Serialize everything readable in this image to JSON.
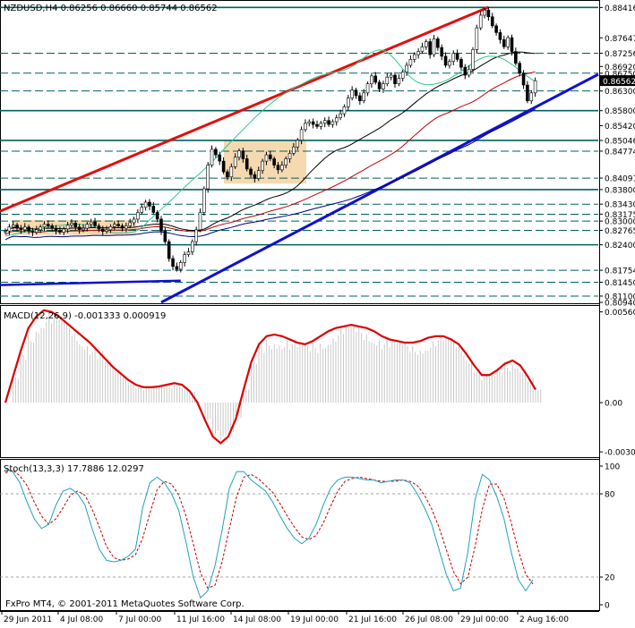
{
  "window": {
    "symbol_header": "NZDUSD,H4  0.86256 0.86660 0.85744 0.86562",
    "copyright": "FxPro MT4, © 2001-2011 MetaQuotes Software Corp."
  },
  "colors": {
    "background": "#ffffff",
    "grid": "#000000",
    "support_resistance": "#006060",
    "trend_red": "#e01010",
    "trend_blue": "#1010d0",
    "ma_fast": "#30c890",
    "ma_slow": "#000000",
    "ma_red": "#c00000",
    "ma_blue": "#000080",
    "consolidation_box": "#f5d9b0",
    "macd_hist": "#c8c8c8",
    "macd_signal": "#dd0000",
    "stoch_main": "#20a0c0",
    "stoch_signal": "#c00000",
    "current_price_box": "#000000"
  },
  "chart_data": [
    {
      "type": "candlestick",
      "title": "NZDUSD,H4  0.86256 0.86660 0.85744 0.86562",
      "ylim": [
        0.8094,
        0.8856
      ],
      "x_labels": [
        "29 Jun 2011",
        "4 Jul 08:00",
        "7 Jul 00:00",
        "11 Jul 16:00",
        "14 Jul 08:00",
        "19 Jul 00:00",
        "21 Jul 16:00",
        "26 Jul 08:00",
        "29 Jul 00:00",
        "2 Aug 16:00"
      ],
      "price_levels": [
        "0.88416",
        "0.87647",
        "0.87256",
        "0.86920",
        "0.86750",
        "0.86562",
        "0.86300",
        "0.85800",
        "0.85420",
        "0.85046",
        "0.84774",
        "0.84091",
        "0.83800",
        "0.83430",
        "0.83175",
        "0.83000",
        "0.82765",
        "0.82400",
        "0.81754",
        "0.81450",
        "0.81100",
        "0.80940"
      ],
      "horizontal_levels": [
        0.88416,
        0.87256,
        0.8675,
        0.863,
        0.858,
        0.85046,
        0.84774,
        0.8409,
        0.838,
        0.8343,
        0.83175,
        0.83,
        0.82765,
        0.824,
        0.81754,
        0.8145,
        0.811
      ],
      "close": [
        0.8275,
        0.8285,
        0.829,
        0.8282,
        0.8278,
        0.8285,
        0.8275,
        0.8272,
        0.8278,
        0.8285,
        0.8292,
        0.8288,
        0.8282,
        0.8276,
        0.8272,
        0.828,
        0.829,
        0.8295,
        0.8285,
        0.8278,
        0.8282,
        0.8292,
        0.8298,
        0.8288,
        0.828,
        0.8274,
        0.8278,
        0.8286,
        0.8292,
        0.8288,
        0.8282,
        0.8288,
        0.8296,
        0.8305,
        0.8322,
        0.8335,
        0.8348,
        0.8338,
        0.8322,
        0.8305,
        0.8275,
        0.8248,
        0.8205,
        0.8185,
        0.8178,
        0.8195,
        0.8215,
        0.8222,
        0.8248,
        0.8278,
        0.8322,
        0.8382,
        0.8442,
        0.8482,
        0.8468,
        0.8452,
        0.8425,
        0.8412,
        0.8438,
        0.8462,
        0.8478,
        0.8458,
        0.8432,
        0.8418,
        0.8408,
        0.8428,
        0.8452,
        0.8468,
        0.8458,
        0.8442,
        0.843,
        0.8442,
        0.8458,
        0.8472,
        0.8488,
        0.8505,
        0.8532,
        0.8548,
        0.8552,
        0.8545,
        0.854,
        0.8548,
        0.8555,
        0.8545,
        0.8552,
        0.8562,
        0.8572,
        0.859,
        0.8612,
        0.8632,
        0.8618,
        0.8605,
        0.8625,
        0.8648,
        0.8668,
        0.8652,
        0.8635,
        0.8648,
        0.8665,
        0.867,
        0.8648,
        0.8662,
        0.8678,
        0.8695,
        0.871,
        0.8722,
        0.873,
        0.8742,
        0.8755,
        0.8722,
        0.8762,
        0.874,
        0.8718,
        0.8695,
        0.8705,
        0.8725,
        0.871,
        0.869,
        0.867,
        0.8685,
        0.8735,
        0.879,
        0.8822,
        0.8835,
        0.8818,
        0.8795,
        0.8778,
        0.876,
        0.8742,
        0.8765,
        0.873,
        0.87,
        0.8675,
        0.8645,
        0.8605,
        0.8625,
        0.8656
      ],
      "series": [
        {
          "name": "MA fast",
          "values": [
            0.8262,
            0.8264,
            0.8266,
            0.8268,
            0.827,
            0.8272,
            0.8274,
            0.8276,
            0.8278,
            0.828,
            0.8282,
            0.8285,
            0.8287,
            0.8288,
            0.8289,
            0.829,
            0.8291,
            0.8292,
            0.8292,
            0.8292,
            0.8291,
            0.829,
            0.8288,
            0.8285,
            0.8281,
            0.8277,
            0.8274,
            0.8272,
            0.827,
            0.827,
            0.827,
            0.827,
            0.8271,
            0.8273,
            0.8277,
            0.8284,
            0.8293,
            0.8303,
            0.8312,
            0.8321,
            0.833,
            0.8339,
            0.8348,
            0.8357,
            0.8367,
            0.8377,
            0.8386,
            0.8395,
            0.8404,
            0.8413,
            0.8422,
            0.8431,
            0.844,
            0.845,
            0.846,
            0.847,
            0.8481,
            0.8492,
            0.8502,
            0.8512,
            0.8522,
            0.8532,
            0.8542,
            0.8552,
            0.8562,
            0.8571,
            0.858,
            0.8589,
            0.8597,
            0.8605,
            0.8612,
            0.8619,
            0.8625,
            0.8631,
            0.8637,
            0.8642,
            0.8647,
            0.8652,
            0.8657,
            0.8662,
            0.8666,
            0.8669,
            0.8672,
            0.8674,
            0.8676,
            0.8678,
            0.868,
            0.8683,
            0.8687,
            0.8692,
            0.8698,
            0.8706,
            0.8714,
            0.8722,
            0.8728,
            0.8732,
            0.8734,
            0.8733,
            0.8728,
            0.872,
            0.871,
            0.8698,
            0.8686,
            0.8675,
            0.8665,
            0.8657,
            0.8651,
            0.8648,
            0.8646,
            0.8646,
            0.8647,
            0.8649,
            0.8652,
            0.8656,
            0.8661,
            0.8667,
            0.8673,
            0.868,
            0.8687,
            0.8694,
            0.8701,
            0.8707,
            0.8712,
            0.8716,
            0.8718,
            0.8718,
            0.8717,
            0.8714,
            0.871,
            0.8704,
            0.8697,
            0.869,
            0.8682,
            0.8674,
            0.8667,
            0.866,
            0.8654
          ]
        }
      ]
    },
    {
      "type": "line",
      "title": "MACD(12,26,9) -0.001333 0.000919",
      "ylim": [
        -0.0032,
        0.0058
      ],
      "tick_labels": [
        "0.00560",
        "0.00",
        "-0.00304"
      ],
      "series": [
        {
          "name": "MACD",
          "values": [
            0.0,
            0.0016,
            0.0032,
            0.0046,
            0.0053,
            0.0057,
            0.0056,
            0.0053,
            0.0049,
            0.0045,
            0.0041,
            0.0037,
            0.0032,
            0.0027,
            0.0022,
            0.0018,
            0.0014,
            0.0011,
            0.00095,
            0.00095,
            0.001,
            0.0011,
            0.0012,
            0.0011,
            0.0007,
            0.0,
            -0.0011,
            -0.0021,
            -0.0025,
            -0.0021,
            -0.001,
            0.0008,
            0.0025,
            0.0036,
            0.0041,
            0.0042,
            0.0041,
            0.0039,
            0.0037,
            0.0036,
            0.0038,
            0.0041,
            0.0044,
            0.0046,
            0.0047,
            0.0048,
            0.0047,
            0.0046,
            0.0044,
            0.0041,
            0.0039,
            0.0038,
            0.0037,
            0.0037,
            0.0038,
            0.004,
            0.0041,
            0.0041,
            0.0039,
            0.0036,
            0.003,
            0.0023,
            0.0017,
            0.0017,
            0.002,
            0.0024,
            0.0026,
            0.0023,
            0.0016,
            0.0008
          ]
        }
      ]
    },
    {
      "type": "line",
      "title": "Stoch(13,3,3) 17.7886 12.0297",
      "ylim": [
        0,
        100
      ],
      "tick_labels": [
        "100",
        "80",
        "20",
        "0"
      ],
      "series": [
        {
          "name": "Stoch main",
          "values": [
            98,
            96,
            88,
            74,
            62,
            55,
            58,
            72,
            82,
            84,
            80,
            72,
            55,
            40,
            32,
            31,
            32,
            35,
            40,
            70,
            88,
            92,
            88,
            80,
            68,
            45,
            20,
            5,
            10,
            28,
            54,
            84,
            96,
            96,
            90,
            86,
            82,
            74,
            64,
            55,
            48,
            44,
            48,
            58,
            72,
            84,
            90,
            92,
            92,
            91,
            90,
            90,
            88,
            89,
            90,
            90,
            88,
            80,
            70,
            58,
            40,
            22,
            10,
            12,
            38,
            76,
            94,
            90,
            78,
            62,
            38,
            18,
            10,
            18
          ]
        },
        {
          "name": "Stoch signal",
          "values": [
            95,
            97,
            93,
            86,
            74,
            64,
            58,
            62,
            70,
            79,
            82,
            79,
            69,
            56,
            42,
            34,
            32,
            33,
            36,
            48,
            66,
            83,
            89,
            87,
            79,
            64,
            44,
            23,
            12,
            14,
            31,
            55,
            78,
            92,
            94,
            91,
            86,
            81,
            73,
            64,
            56,
            49,
            47,
            50,
            59,
            71,
            82,
            89,
            91,
            92,
            91,
            90,
            89,
            89,
            89,
            90,
            89,
            86,
            79,
            69,
            56,
            40,
            24,
            15,
            20,
            42,
            69,
            87,
            87,
            77,
            59,
            39,
            22,
            15
          ]
        }
      ]
    }
  ]
}
